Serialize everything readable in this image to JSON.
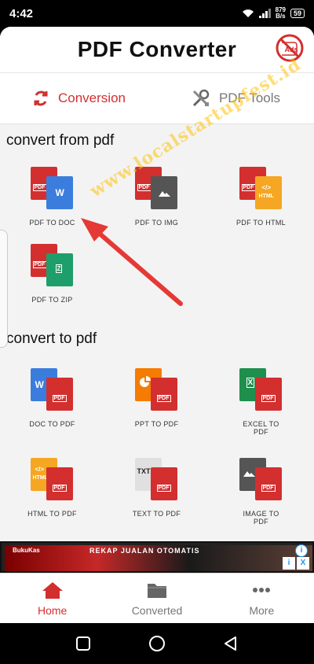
{
  "status": {
    "time": "4:42",
    "net_speed_value": "879",
    "net_speed_unit": "B/s",
    "battery": "59"
  },
  "header": {
    "title": "PDF Converter",
    "noads_label": "Ads"
  },
  "tabs": [
    {
      "label": "Conversion",
      "icon": "refresh-icon",
      "active": true
    },
    {
      "label": "PDF Tools",
      "icon": "tools-icon",
      "active": false
    }
  ],
  "from_pdf": {
    "title": "convert from pdf",
    "items": [
      {
        "label": "PDF TO DOC"
      },
      {
        "label": "PDF TO IMG"
      },
      {
        "label": "PDF TO HTML"
      },
      {
        "label": "PDF TO ZIP"
      }
    ]
  },
  "to_pdf": {
    "title": "convert to pdf",
    "items": [
      {
        "label": "DOC TO PDF"
      },
      {
        "label": "PPT TO PDF"
      },
      {
        "label": "EXCEL TO PDF"
      },
      {
        "label": "HTML TO PDF"
      },
      {
        "label": "TEXT TO PDF"
      },
      {
        "label": "IMAGE TO PDF"
      }
    ]
  },
  "icon_tags": {
    "pdf": "PDF",
    "word": "W",
    "html": "</>",
    "html_label": "HTML",
    "zip": "Z",
    "excel": "X",
    "txt": "TXT"
  },
  "watermark": "www.localstartupfest.id",
  "ad": {
    "brand": "BukuKas",
    "text": "REKAP JUALAN OTOMATIS",
    "info": "i",
    "close": "X"
  },
  "bottom_nav": [
    {
      "label": "Home",
      "active": true
    },
    {
      "label": "Converted",
      "active": false
    },
    {
      "label": "More",
      "active": false
    }
  ],
  "colors": {
    "accent": "#d32f2f",
    "pdf_red": "#d32f2f",
    "word_blue": "#3b7ddd",
    "img_gray": "#555555",
    "html_orange": "#f5a623",
    "zip_green": "#1e9e6a",
    "ppt_orange": "#f57c00",
    "excel_green": "#1f8f4e",
    "txt_gray": "#e0e0e0"
  }
}
